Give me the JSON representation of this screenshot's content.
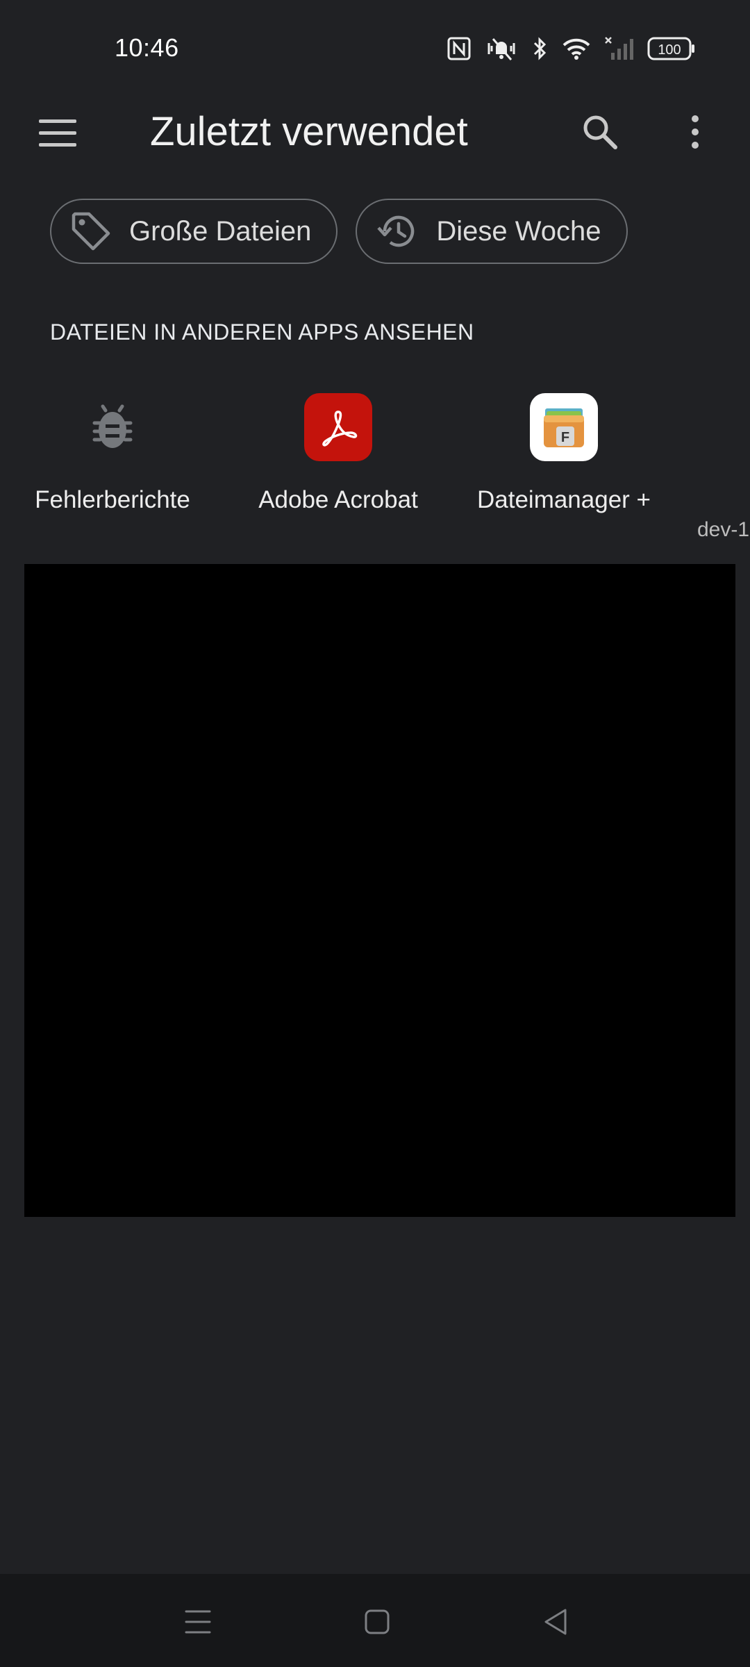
{
  "status_bar": {
    "time": "10:46",
    "battery": "100",
    "icons": [
      "nfc-icon",
      "vibrate-mute-icon",
      "bluetooth-icon",
      "wifi-icon",
      "signal-icon",
      "battery-icon"
    ]
  },
  "app_bar": {
    "title": "Zuletzt verwendet",
    "icons": [
      "menu-icon",
      "search-icon",
      "more-vert-icon"
    ]
  },
  "chips": [
    {
      "label": "Große Dateien",
      "icon": "tag-icon"
    },
    {
      "label": "Diese Woche",
      "icon": "history-icon"
    }
  ],
  "section": {
    "header": "DATEIEN IN ANDEREN APPS ANSEHEN"
  },
  "apps": [
    {
      "label": "Fehlerberichte",
      "icon": "bug-icon"
    },
    {
      "label": "Adobe Acrobat",
      "icon": "acrobat-icon",
      "color": "#c4130c"
    },
    {
      "label": "Dateimanager +",
      "icon": "file-manager-icon"
    }
  ],
  "partial_app_label": "dev-1",
  "nav_bar": {
    "buttons": [
      "recents-icon",
      "home-icon",
      "back-icon"
    ]
  },
  "colors": {
    "background": "#202124",
    "panel": "#000000",
    "nav_bar": "#161719",
    "acrobat_red": "#c4130c"
  }
}
